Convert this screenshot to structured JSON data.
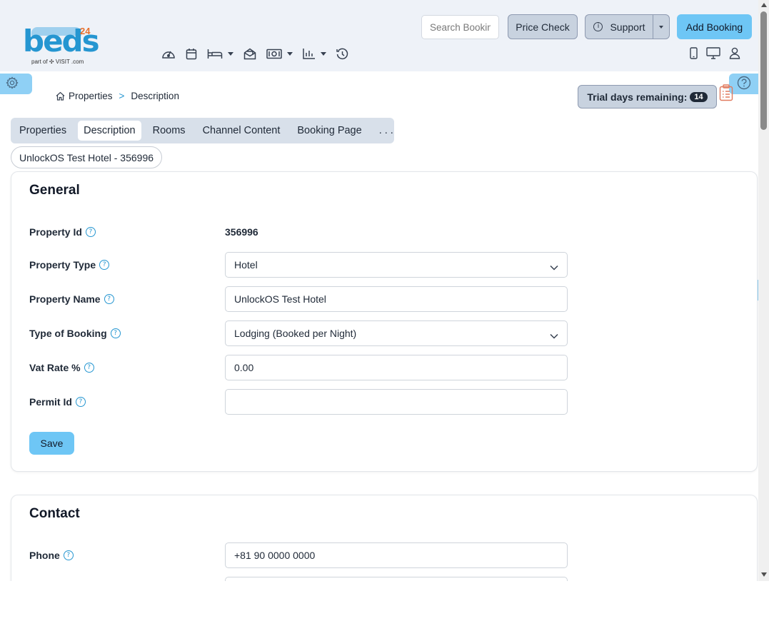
{
  "brand": {
    "logo_text": "beds",
    "logo_suffix": "24",
    "logo_sub": "part of ✣ VISIT .com"
  },
  "header": {
    "search_placeholder": "Search Bookings",
    "price_check_label": "Price Check",
    "support_label": "Support",
    "add_booking_label": "Add Booking",
    "nav_icons": [
      "dashboard-icon",
      "calendar-icon",
      "bed-icon",
      "inbox-icon",
      "money-icon",
      "chart-icon",
      "history-icon"
    ],
    "device_icons": [
      "mobile-icon",
      "desktop-icon",
      "user-icon"
    ]
  },
  "breadcrumb": {
    "root": "Properties",
    "separator": ">",
    "current": "Description"
  },
  "trial": {
    "label": "Trial days remaining:",
    "days": "14"
  },
  "tabs": [
    {
      "label": "Properties",
      "active": false
    },
    {
      "label": "Description",
      "active": true
    },
    {
      "label": "Rooms",
      "active": false
    },
    {
      "label": "Channel Content",
      "active": false
    },
    {
      "label": "Booking Page",
      "active": false
    },
    {
      "label": ". . .",
      "active": false
    }
  ],
  "property_pill": "UnlockOS Test Hotel - 356996",
  "general": {
    "title": "General",
    "property_id_label": "Property Id",
    "property_id_value": "356996",
    "property_type_label": "Property Type",
    "property_type_value": "Hotel",
    "property_name_label": "Property Name",
    "property_name_value": "UnlockOS Test Hotel",
    "type_of_booking_label": "Type of Booking",
    "type_of_booking_value": "Lodging (Booked per Night)",
    "vat_rate_label": "Vat Rate %",
    "vat_rate_value": "0.00",
    "permit_id_label": "Permit Id",
    "permit_id_value": "",
    "save_label": "Save"
  },
  "contact": {
    "title": "Contact",
    "phone_label": "Phone",
    "phone_value": "+81 90 0000 0000"
  },
  "colors": {
    "accent": "#6ec6f5",
    "brand": "#2596d1",
    "header_bg": "#eef2f8",
    "gray_button": "#c8d2df"
  }
}
